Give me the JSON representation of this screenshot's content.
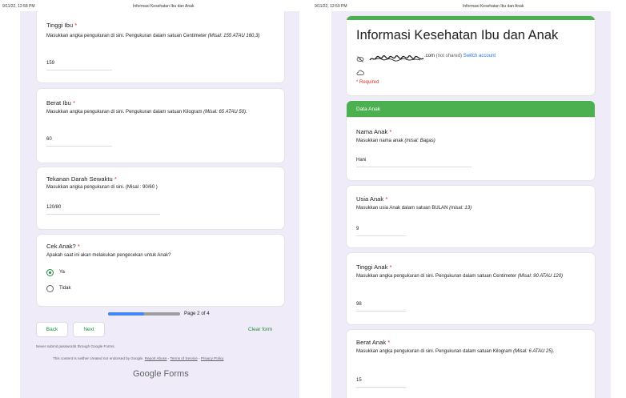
{
  "left_header": {
    "datetime": "9/11/22, 12:58 PM",
    "title": "Informasi Kesehatan Ibu dan Anak"
  },
  "right_header": {
    "datetime": "9/11/22, 12:59 PM",
    "title": "Informasi Kesehatan Ibu dan Anak"
  },
  "left": {
    "tinggi_ibu": {
      "label": "Tinggi Ibu",
      "req": "*",
      "desc": "Masukkan angka pengukuran di sini. Pengukuran dalam satuan Centimeter",
      "example": "(Misal: 155 ATAU 160,3)",
      "value": "159"
    },
    "berat_ibu": {
      "label": "Berat Ibu",
      "req": "*",
      "desc": "Masukkan angka pengukuran di sini. Pengukuran dalam satuan Kilogram",
      "example": "(Misal: 65 ATAU 50).",
      "value": "60"
    },
    "tekanan": {
      "label": "Tekanan Darah Sewaktu",
      "req": "*",
      "desc": "Masukkan angka pengukuran di sini. (Misal : 90/60 )",
      "value": "120/80"
    },
    "cek_anak": {
      "label": "Cek Anak?",
      "req": "*",
      "desc": "Apakah saat ini akan melakukan pengecekan untuk Anak?",
      "options": [
        "Ya",
        "Tidak"
      ],
      "selected": "Ya"
    },
    "progress": {
      "label": "Page 2 of 4",
      "fraction": 0.5
    },
    "back": "Back",
    "next": "Next",
    "clear": "Clear form",
    "never_submit": "Never submit passwords through Google Forms.",
    "disclaimer_text": "This content is neither created nor endorsed by Google.",
    "report_abuse": "Report Abuse",
    "sep": "-",
    "terms": "Terms of Service",
    "privacy": "Privacy Policy",
    "logo": "Google Forms"
  },
  "right": {
    "form_title": "Informasi Kesehatan Ibu dan Anak",
    "account_suffix": ".com",
    "not_shared": "(not shared)",
    "switch_account": "Switch account",
    "required_note": "* Required",
    "section": "Data Anak",
    "nama": {
      "label": "Nama Anak",
      "req": "*",
      "desc": "Masukkan nama anak",
      "example": "(misal: Bagas)",
      "value": "Hani"
    },
    "usia": {
      "label": "Usia Anak",
      "req": "*",
      "desc": "Masukkan usia Anak dalam satuan BULAN",
      "example": "(misal: 13)",
      "value": "9"
    },
    "tinggi": {
      "label": "Tinggi Anak",
      "req": "*",
      "desc": "Masukkan angka pengukuran di sini. Pengukuran dalam satuan Centimeter",
      "example": "(Misal: 90 ATAU 120)",
      "value": "98"
    },
    "berat": {
      "label": "Berat Anak",
      "req": "*",
      "desc": "Masukkan angka pengukuran di sini. Pengukuran dalam satuan Kilogram",
      "example": "(Misal: 6 ATAU 25).",
      "value": "15"
    }
  },
  "colors": {
    "accent": "#1e8e3e",
    "section_green": "#4caf50",
    "progress_blue": "#4285f4",
    "background": "#f0ebf8",
    "required": "#d93025"
  }
}
